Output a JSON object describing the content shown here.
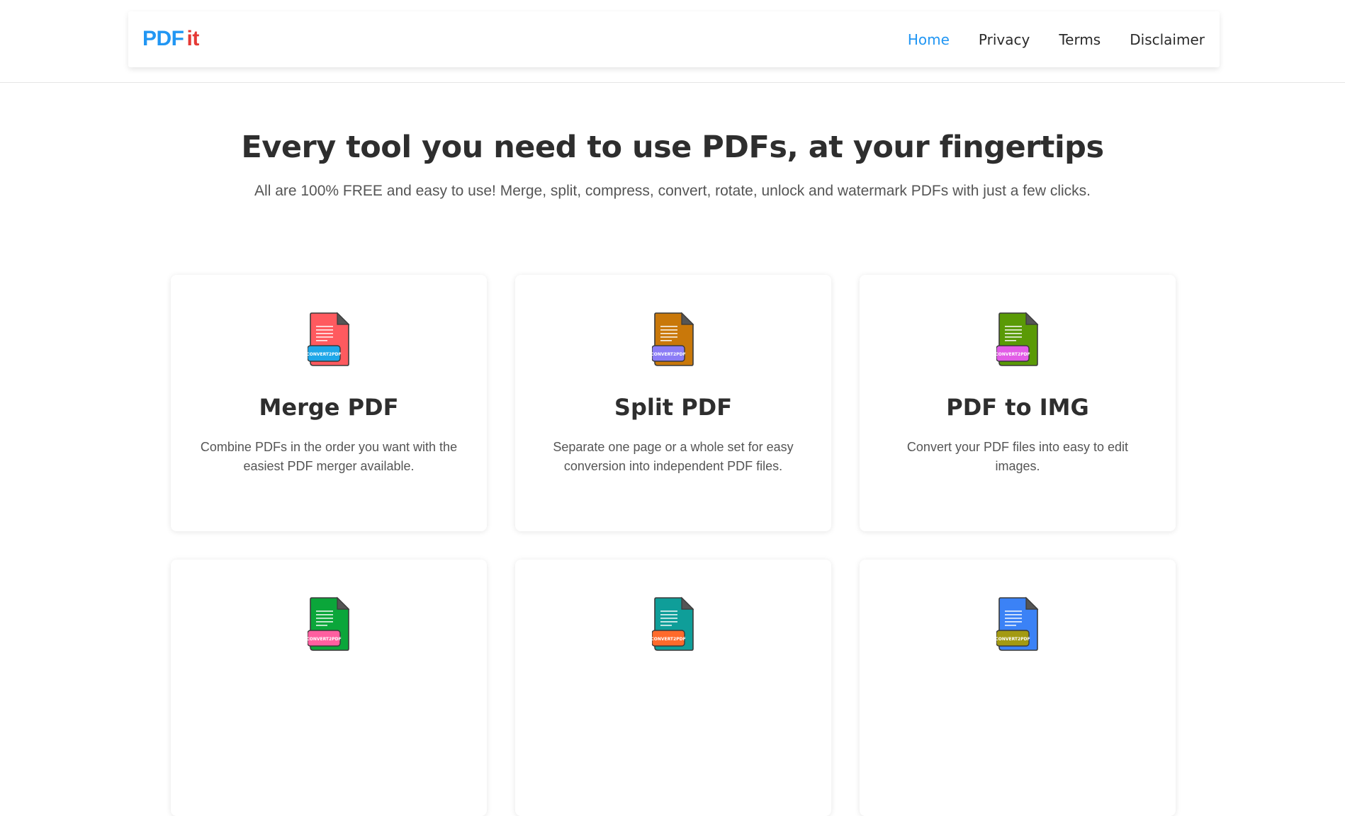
{
  "header": {
    "logo": {
      "part1": "PDF",
      "part2": "it"
    },
    "nav": [
      {
        "label": "Home"
      },
      {
        "label": "Privacy"
      },
      {
        "label": "Terms"
      },
      {
        "label": "Disclaimer"
      }
    ]
  },
  "hero": {
    "title": "Every tool you need to use PDFs, at your fingertips",
    "subtitle": "All are 100% FREE and easy to use! Merge, split, compress, convert, rotate, unlock and watermark PDFs with just a few clicks."
  },
  "tools": [
    {
      "title": "Merge PDF",
      "description": "Combine PDFs in the order you want with the easiest PDF merger available.",
      "icon_name": "merge-pdf-file-icon",
      "file_color": "#ff5a5f",
      "tag_color": "#1ea7e8",
      "tag_text": "CONVERT2PDF"
    },
    {
      "title": "Split PDF",
      "description": "Separate one page or a whole set for easy conversion into independent PDF files.",
      "icon_name": "split-pdf-file-icon",
      "file_color": "#c9780a",
      "tag_color": "#8b7cf6",
      "tag_text": "CONVERT2PDF"
    },
    {
      "title": "PDF to IMG",
      "description": "Convert your PDF files into easy to edit images.",
      "icon_name": "pdf-to-img-file-icon",
      "file_color": "#5a9a06",
      "tag_color": "#e25ce6",
      "tag_text": "CONVERT2PDF"
    },
    {
      "title": "",
      "description": "",
      "icon_name": "tool-file-icon",
      "file_color": "#0ba63a",
      "tag_color": "#ff5fa0",
      "tag_text": "CONVERT2PDF"
    },
    {
      "title": "",
      "description": "",
      "icon_name": "tool-file-icon",
      "file_color": "#0f9e99",
      "tag_color": "#ff6a2b",
      "tag_text": "CONVERT2PDF"
    },
    {
      "title": "",
      "description": "",
      "icon_name": "tool-file-icon",
      "file_color": "#3b82f6",
      "tag_color": "#a39a12",
      "tag_text": "CONVERT2PDF"
    }
  ]
}
